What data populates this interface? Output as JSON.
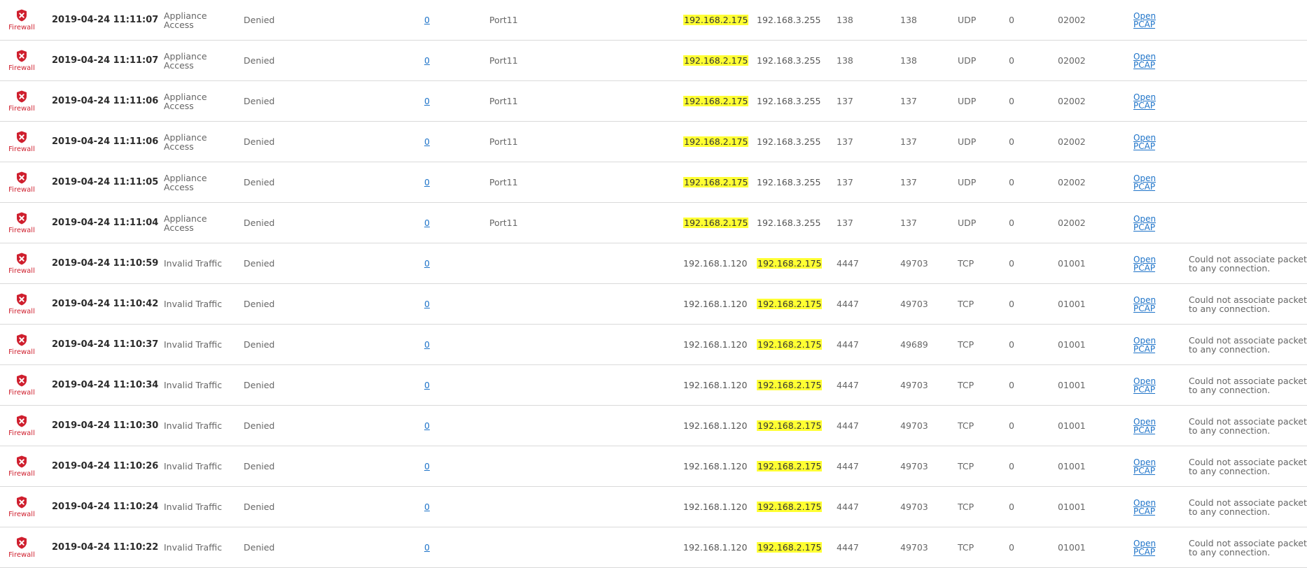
{
  "table": {
    "rows": [
      {
        "module": "Firewall",
        "time": "2019-04-24 11:11:07",
        "type": "Appliance Access",
        "status": "Denied",
        "count": "0",
        "iface": "Port11",
        "src": "192.168.2.175",
        "dst": "192.168.3.255",
        "sport": "138",
        "dport": "138",
        "proto": "UDP",
        "zero": "0",
        "rule": "02002",
        "pcap1": "Open",
        "pcap2": "PCAP",
        "msg": "",
        "hl": "src"
      },
      {
        "module": "Firewall",
        "time": "2019-04-24 11:11:07",
        "type": "Appliance Access",
        "status": "Denied",
        "count": "0",
        "iface": "Port11",
        "src": "192.168.2.175",
        "dst": "192.168.3.255",
        "sport": "138",
        "dport": "138",
        "proto": "UDP",
        "zero": "0",
        "rule": "02002",
        "pcap1": "Open",
        "pcap2": "PCAP",
        "msg": "",
        "hl": "src"
      },
      {
        "module": "Firewall",
        "time": "2019-04-24 11:11:06",
        "type": "Appliance Access",
        "status": "Denied",
        "count": "0",
        "iface": "Port11",
        "src": "192.168.2.175",
        "dst": "192.168.3.255",
        "sport": "137",
        "dport": "137",
        "proto": "UDP",
        "zero": "0",
        "rule": "02002",
        "pcap1": "Open",
        "pcap2": "PCAP",
        "msg": "",
        "hl": "src"
      },
      {
        "module": "Firewall",
        "time": "2019-04-24 11:11:06",
        "type": "Appliance Access",
        "status": "Denied",
        "count": "0",
        "iface": "Port11",
        "src": "192.168.2.175",
        "dst": "192.168.3.255",
        "sport": "137",
        "dport": "137",
        "proto": "UDP",
        "zero": "0",
        "rule": "02002",
        "pcap1": "Open",
        "pcap2": "PCAP",
        "msg": "",
        "hl": "src"
      },
      {
        "module": "Firewall",
        "time": "2019-04-24 11:11:05",
        "type": "Appliance Access",
        "status": "Denied",
        "count": "0",
        "iface": "Port11",
        "src": "192.168.2.175",
        "dst": "192.168.3.255",
        "sport": "137",
        "dport": "137",
        "proto": "UDP",
        "zero": "0",
        "rule": "02002",
        "pcap1": "Open",
        "pcap2": "PCAP",
        "msg": "",
        "hl": "src"
      },
      {
        "module": "Firewall",
        "time": "2019-04-24 11:11:04",
        "type": "Appliance Access",
        "status": "Denied",
        "count": "0",
        "iface": "Port11",
        "src": "192.168.2.175",
        "dst": "192.168.3.255",
        "sport": "137",
        "dport": "137",
        "proto": "UDP",
        "zero": "0",
        "rule": "02002",
        "pcap1": "Open",
        "pcap2": "PCAP",
        "msg": "",
        "hl": "src"
      },
      {
        "module": "Firewall",
        "time": "2019-04-24 11:10:59",
        "type": "Invalid Traffic",
        "status": "Denied",
        "count": "0",
        "iface": "",
        "src": "192.168.1.120",
        "dst": "192.168.2.175",
        "sport": "4447",
        "dport": "49703",
        "proto": "TCP",
        "zero": "0",
        "rule": "01001",
        "pcap1": "Open",
        "pcap2": "PCAP",
        "msg": "Could not associate packet to any connection.",
        "hl": "dst"
      },
      {
        "module": "Firewall",
        "time": "2019-04-24 11:10:42",
        "type": "Invalid Traffic",
        "status": "Denied",
        "count": "0",
        "iface": "",
        "src": "192.168.1.120",
        "dst": "192.168.2.175",
        "sport": "4447",
        "dport": "49703",
        "proto": "TCP",
        "zero": "0",
        "rule": "01001",
        "pcap1": "Open",
        "pcap2": "PCAP",
        "msg": "Could not associate packet to any connection.",
        "hl": "dst"
      },
      {
        "module": "Firewall",
        "time": "2019-04-24 11:10:37",
        "type": "Invalid Traffic",
        "status": "Denied",
        "count": "0",
        "iface": "",
        "src": "192.168.1.120",
        "dst": "192.168.2.175",
        "sport": "4447",
        "dport": "49689",
        "proto": "TCP",
        "zero": "0",
        "rule": "01001",
        "pcap1": "Open",
        "pcap2": "PCAP",
        "msg": "Could not associate packet to any connection.",
        "hl": "dst"
      },
      {
        "module": "Firewall",
        "time": "2019-04-24 11:10:34",
        "type": "Invalid Traffic",
        "status": "Denied",
        "count": "0",
        "iface": "",
        "src": "192.168.1.120",
        "dst": "192.168.2.175",
        "sport": "4447",
        "dport": "49703",
        "proto": "TCP",
        "zero": "0",
        "rule": "01001",
        "pcap1": "Open",
        "pcap2": "PCAP",
        "msg": "Could not associate packet to any connection.",
        "hl": "dst"
      },
      {
        "module": "Firewall",
        "time": "2019-04-24 11:10:30",
        "type": "Invalid Traffic",
        "status": "Denied",
        "count": "0",
        "iface": "",
        "src": "192.168.1.120",
        "dst": "192.168.2.175",
        "sport": "4447",
        "dport": "49703",
        "proto": "TCP",
        "zero": "0",
        "rule": "01001",
        "pcap1": "Open",
        "pcap2": "PCAP",
        "msg": "Could not associate packet to any connection.",
        "hl": "dst"
      },
      {
        "module": "Firewall",
        "time": "2019-04-24 11:10:26",
        "type": "Invalid Traffic",
        "status": "Denied",
        "count": "0",
        "iface": "",
        "src": "192.168.1.120",
        "dst": "192.168.2.175",
        "sport": "4447",
        "dport": "49703",
        "proto": "TCP",
        "zero": "0",
        "rule": "01001",
        "pcap1": "Open",
        "pcap2": "PCAP",
        "msg": "Could not associate packet to any connection.",
        "hl": "dst"
      },
      {
        "module": "Firewall",
        "time": "2019-04-24 11:10:24",
        "type": "Invalid Traffic",
        "status": "Denied",
        "count": "0",
        "iface": "",
        "src": "192.168.1.120",
        "dst": "192.168.2.175",
        "sport": "4447",
        "dport": "49703",
        "proto": "TCP",
        "zero": "0",
        "rule": "01001",
        "pcap1": "Open",
        "pcap2": "PCAP",
        "msg": "Could not associate packet to any connection.",
        "hl": "dst"
      },
      {
        "module": "Firewall",
        "time": "2019-04-24 11:10:22",
        "type": "Invalid Traffic",
        "status": "Denied",
        "count": "0",
        "iface": "",
        "src": "192.168.1.120",
        "dst": "192.168.2.175",
        "sport": "4447",
        "dport": "49703",
        "proto": "TCP",
        "zero": "0",
        "rule": "01001",
        "pcap1": "Open",
        "pcap2": "PCAP",
        "msg": "Could not associate packet to any connection.",
        "hl": "dst"
      }
    ]
  },
  "colors": {
    "module_red": "#cf1f2e",
    "link_blue": "#1f74c9",
    "highlight_yellow": "#ffff33",
    "row_border": "#dadada"
  },
  "icons": {
    "module": "shield-x-icon"
  }
}
